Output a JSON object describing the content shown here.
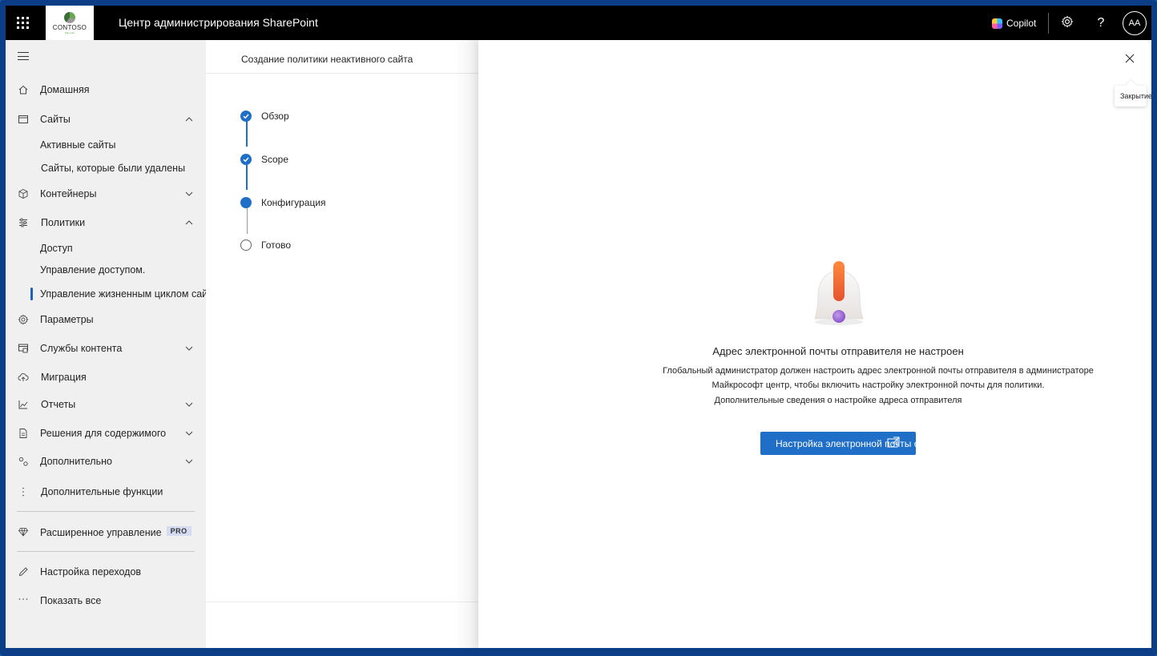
{
  "topbar": {
    "app_title": "Центр администрирования SharePoint",
    "logo_text": "CONTOSO",
    "logo_sub": "Main site",
    "copilot_label": "Copilot",
    "avatar_initials": "AA",
    "waffle_icon": "waffle-icon",
    "settings_icon": "gear-icon",
    "help_icon": "help-icon"
  },
  "sidebar": {
    "items": [
      {
        "label": "Домашняя",
        "icon": "home-icon"
      },
      {
        "label": "Сайты",
        "icon": "browser-icon",
        "expanded": true
      },
      {
        "label": "Активные сайты"
      },
      {
        "label": "Сайты, которые были удалены"
      },
      {
        "label": "Контейнеры",
        "icon": "cube-icon",
        "expanded": false
      },
      {
        "label": "Политики",
        "icon": "sliders-icon",
        "expanded": true
      },
      {
        "label": "Доступ"
      },
      {
        "label": "Управление доступом."
      },
      {
        "label": "Управление жизненным циклом сайта",
        "active": true
      },
      {
        "label": "Параметры",
        "icon": "gear-icon"
      },
      {
        "label": "Службы контента",
        "icon": "content-services-icon",
        "expanded": false
      },
      {
        "label": "Миграция",
        "icon": "cloud-upload-icon"
      },
      {
        "label": "Отчеты",
        "icon": "chart-icon",
        "expanded": false
      },
      {
        "label": "Решения для содержимого",
        "icon": "document-icon",
        "expanded": false
      },
      {
        "label": "Дополнительно",
        "icon": "settings-advanced-icon",
        "expanded": false
      },
      {
        "label": "Дополнительные функции",
        "icon": "more-vertical-icon"
      },
      {
        "label": "Расширенное управление",
        "icon": "diamond-icon",
        "badge": "PRO"
      },
      {
        "label": "Настройка переходов",
        "icon": "pencil-icon"
      },
      {
        "label": "Показать все",
        "icon": "more-horizontal-icon"
      }
    ]
  },
  "wizard": {
    "title": "Создание политики неактивного сайта",
    "steps": [
      {
        "label": "Обзор",
        "state": "done"
      },
      {
        "label": "Scope",
        "state": "done"
      },
      {
        "label": "Конфигурация",
        "state": "current"
      },
      {
        "label": "Готово",
        "state": "todo"
      }
    ]
  },
  "panel": {
    "close_tooltip": "Закрытие",
    "message_title": "Адрес электронной почты отправителя не настроен",
    "message_body": "Глобальный администратор должен настроить адрес электронной почты отправителя в администраторе Майкрософт центр, чтобы включить настройку электронной почты для политики.",
    "learn_more": "Дополнительные сведения о настройке адреса отправителя",
    "primary_button": "Настройка электронной почты отп",
    "illustration": "warning-bell-icon"
  },
  "colors": {
    "accent": "#1f6fc8",
    "topbar": "#000000",
    "sidebar": "#f0f0f0",
    "frame": "#0b3e86"
  }
}
